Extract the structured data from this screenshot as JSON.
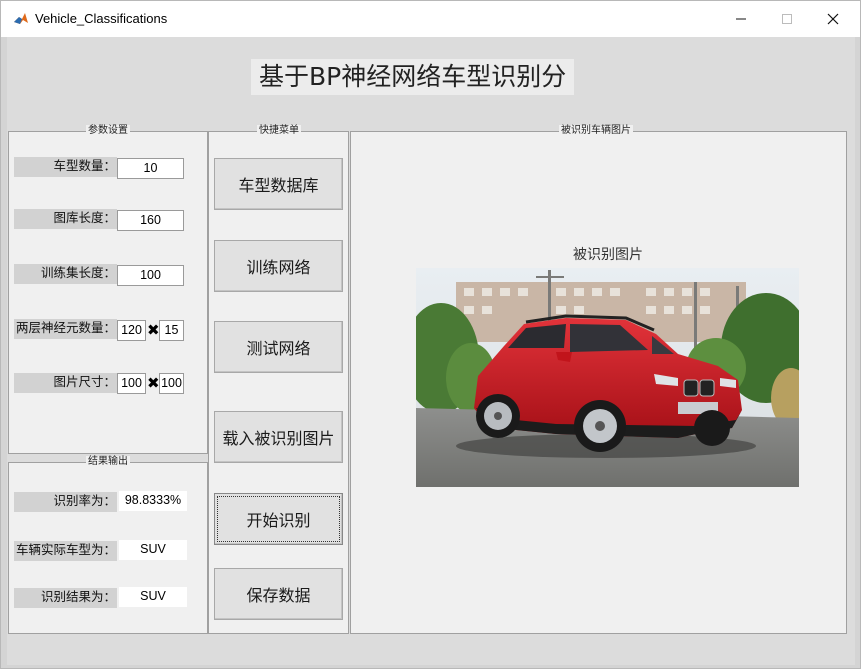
{
  "window": {
    "title": "Vehicle_Classifications"
  },
  "header": {
    "title": "基于BP神经网络车型识别分"
  },
  "params": {
    "title": "参数设置",
    "type_count": {
      "label": "车型数量：",
      "value": "10"
    },
    "library_length": {
      "label": "图库长度：",
      "value": "160"
    },
    "training_length": {
      "label": "训练集长度：",
      "value": "100"
    },
    "neurons": {
      "label": "两层神经元数量：",
      "value1": "120",
      "value2": "15"
    },
    "image_size": {
      "label": "图片尺寸：",
      "value1": "100",
      "value2": "100"
    }
  },
  "results": {
    "title": "结果输出",
    "accuracy": {
      "label": "识别率为：",
      "value": "98.8333%"
    },
    "actual_type": {
      "label": "车辆实际车型为：",
      "value": "SUV"
    },
    "result_type": {
      "label": "识别结果为：",
      "value": "SUV"
    }
  },
  "menu": {
    "title": "快捷菜单",
    "buttons": [
      "车型数据库",
      "训练网络",
      "测试网络",
      "载入被识别图片",
      "开始识别",
      "保存数据"
    ]
  },
  "image_panel": {
    "title": "被识别车辆图片",
    "axes_title": "被识别图片"
  },
  "colors": {
    "car_body": "#c8141c",
    "background": "#dcdcdc",
    "panel": "#f0f0f0"
  }
}
